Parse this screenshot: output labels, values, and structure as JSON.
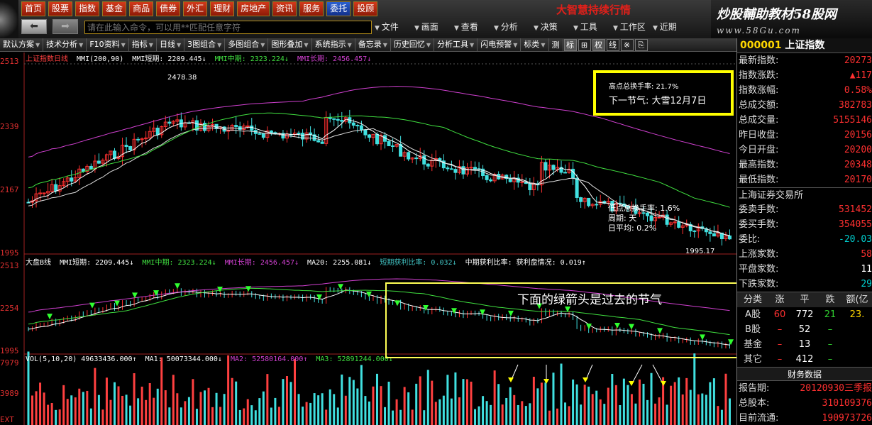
{
  "nav": [
    "首页",
    "股票",
    "指数",
    "基金",
    "商品",
    "债券",
    "外汇",
    "理财",
    "房地产",
    "资讯",
    "服务",
    "委托",
    "投顾"
  ],
  "slogan": "大智慧持续行情",
  "brand": {
    "line1": "炒股輔助教材58股网",
    "line2": "www.58Gu.com"
  },
  "command_placeholder": "请在此输入命令，可以用**匹配任意字符",
  "menus": [
    "文件",
    "画面",
    "查看",
    "分析",
    "决策",
    "工具",
    "工作区",
    "近期"
  ],
  "toolbar": [
    "默认方案",
    "技术分析",
    "F10资料",
    "指标",
    "日线",
    "3图组合",
    "多图组合",
    "图形叠加",
    "系统指示",
    "备忘录",
    "历史回忆",
    "分析工具",
    "闪电预警",
    "标类",
    "测"
  ],
  "toolbar_buttons": [
    "标",
    "⊞",
    "权",
    "线",
    "※",
    "⎘"
  ],
  "main_legend": {
    "prefix": "上证指数日线",
    "items": [
      "MMI(200,90)",
      "MMI短期: 2209.445↓",
      "MMI中期: 2323.224↓",
      "MMI长期: 2456.457↓"
    ]
  },
  "main_axis": [
    "2513",
    "2339",
    "2167",
    "1995"
  ],
  "sub_legend": {
    "items": [
      "大盘B线",
      "MMI短期: 2209.445↓",
      "MMI中期: 2323.224↓",
      "MMI长期: 2456.457↓",
      "MA20: 2255.081↓",
      "短期获利比率: 0.032↓",
      "中期获利比率: 获利盘情况: 0.019↑"
    ]
  },
  "sub_axis": [
    "2513",
    "2254",
    "1995"
  ],
  "vol_legend": {
    "items": [
      "VOL(5,10,20) 49633436.000↑",
      "MA1: 50073344.000↓",
      "MA2: 52580164.000↑",
      "MA3: 52891244.000↓"
    ]
  },
  "vol_axis": [
    "7979",
    "3989",
    "EXT"
  ],
  "annotation_box": {
    "line1": "高点总换手率: 21.7%",
    "line2": "下一节气: 大雪12月7日"
  },
  "annotation_green": "下面的绿箭头是过去的节气",
  "high_label": "2478.38",
  "low_label": "1995.17",
  "low_info": [
    "低点总换手率: 1.6%",
    "周期: 天",
    "日平均: 0.2%"
  ],
  "panel": {
    "code": "000001",
    "name": "上证指数",
    "rows": [
      {
        "k": "最新指数:",
        "v": "20273"
      },
      {
        "k": "指数涨跌:",
        "v": "▲117"
      },
      {
        "k": "指数涨幅:",
        "v": "0.58%"
      },
      {
        "k": "总成交额:",
        "v": "382783"
      },
      {
        "k": "总成交量:",
        "v": "5155146"
      },
      {
        "k": "昨日收盘:",
        "v": "20156"
      },
      {
        "k": "今日开盘:",
        "v": "20200"
      },
      {
        "k": "最高指数:",
        "v": "20348"
      },
      {
        "k": "最低指数:",
        "v": "20170"
      }
    ],
    "exchange": "上海证券交易所",
    "rows2": [
      {
        "k": "委卖手数:",
        "v": "531452"
      },
      {
        "k": "委买手数:",
        "v": "354055"
      },
      {
        "k": "委比:",
        "v": "-20.03"
      },
      {
        "k": "上涨家数:",
        "v": "58"
      },
      {
        "k": "平盘家数:",
        "v": "11"
      },
      {
        "k": "下跌家数:",
        "v": "29"
      }
    ],
    "stats_header": [
      "分类",
      "涨",
      "平",
      "跌",
      "额(亿"
    ],
    "stats": [
      [
        "A股",
        "60",
        "772",
        "21",
        "23."
      ],
      [
        "B股",
        "–",
        "52",
        "–",
        ""
      ],
      [
        "基金",
        "–",
        "13",
        "–",
        ""
      ],
      [
        "其它",
        "–",
        "412",
        "–",
        ""
      ]
    ],
    "fin_title": "财务数据",
    "fin_rows": [
      {
        "k": "报告期:",
        "v": "20120930三季报"
      },
      {
        "k": "总股本:",
        "v": "310109376"
      },
      {
        "k": "目前流通:",
        "v": "190973726"
      }
    ]
  }
}
